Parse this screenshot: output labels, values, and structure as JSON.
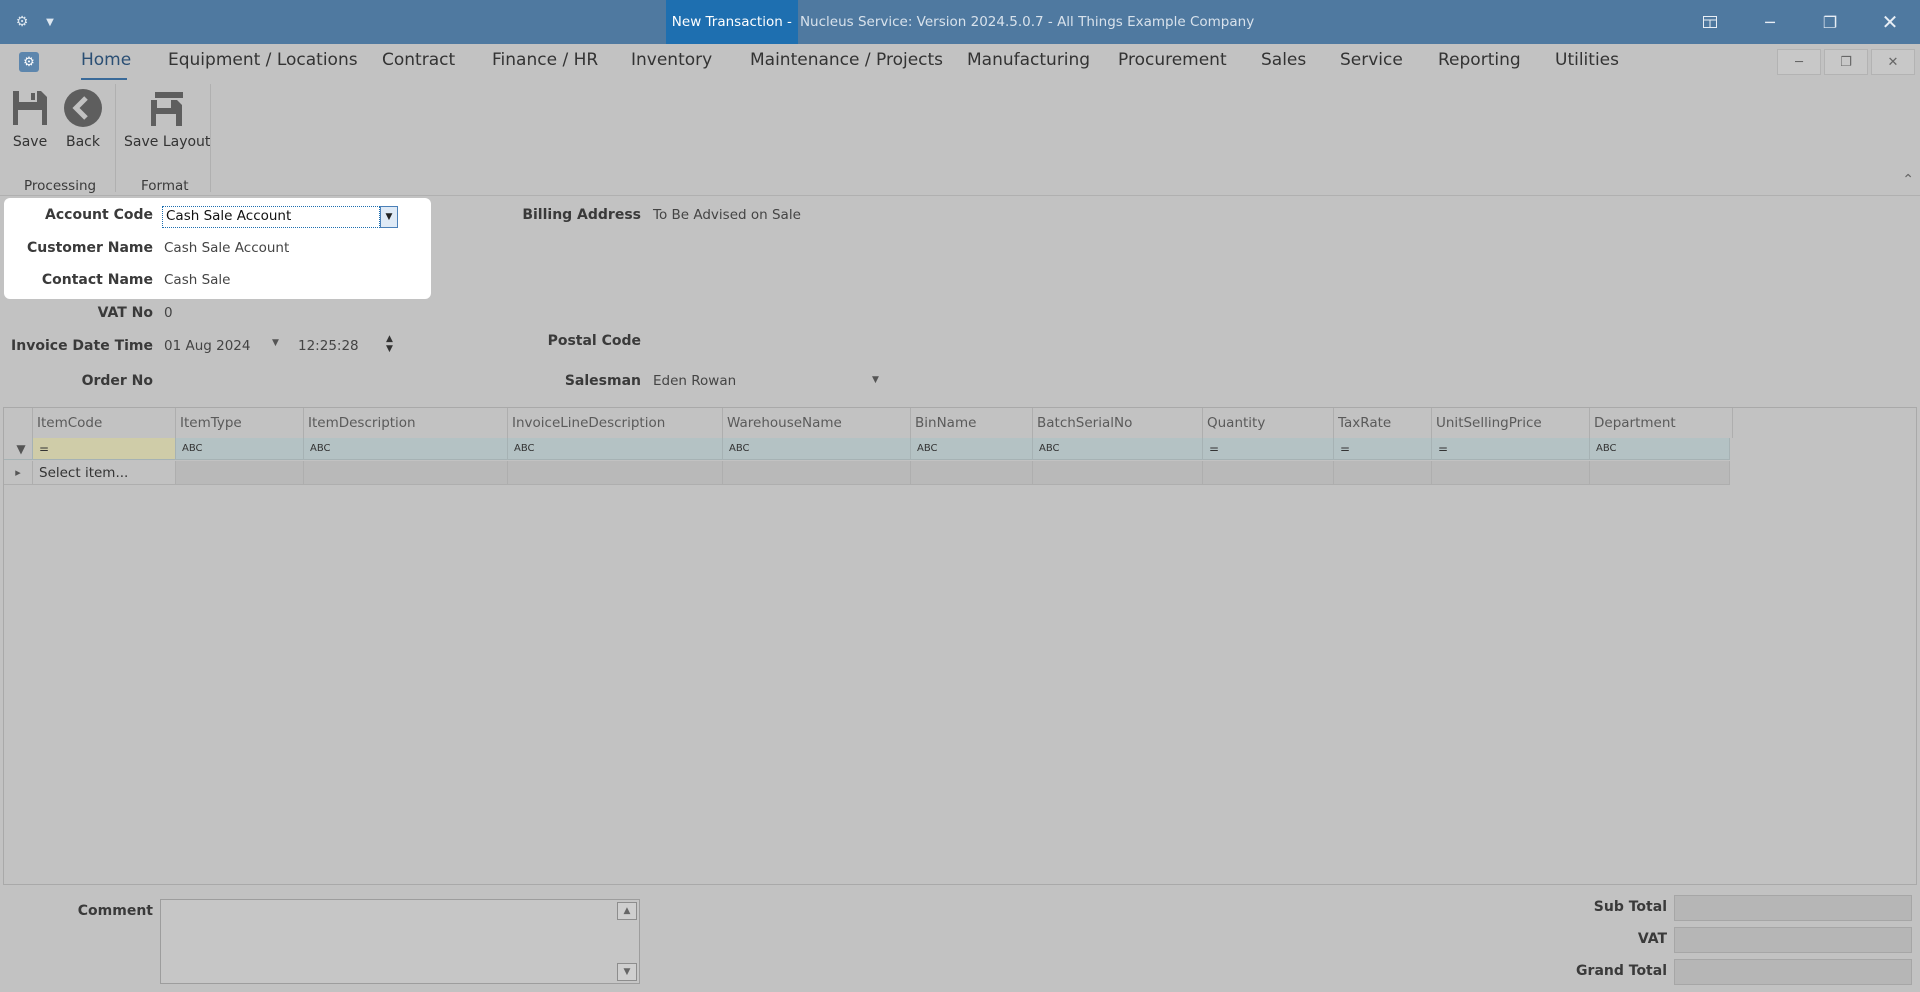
{
  "titlebar": {
    "doc_title": "New Transaction -",
    "rest_title": "Nucleus Service: Version 2024.5.0.7 - All Things Example Company"
  },
  "menu": {
    "items": [
      "Home",
      "Equipment / Locations",
      "Contract",
      "Finance / HR",
      "Inventory",
      "Maintenance / Projects",
      "Manufacturing",
      "Procurement",
      "Sales",
      "Service",
      "Reporting",
      "Utilities"
    ],
    "active": "Home"
  },
  "ribbon": {
    "save": "Save",
    "back": "Back",
    "save_layout": "Save Layout",
    "group_processing": "Processing",
    "group_format": "Format"
  },
  "form": {
    "account_code_label": "Account Code",
    "account_code_value": "Cash Sale Account",
    "customer_name_label": "Customer Name",
    "customer_name_value": "Cash Sale Account",
    "contact_name_label": "Contact Name",
    "contact_name_value": "Cash Sale",
    "vat_no_label": "VAT No",
    "vat_no_value": "0",
    "invoice_dt_label": "Invoice Date Time",
    "invoice_date": "01 Aug 2024",
    "invoice_time": "12:25:28",
    "order_no_label": "Order No",
    "billing_address_label": "Billing Address",
    "billing_address_value": "To Be Advised on Sale",
    "postal_code_label": "Postal Code",
    "salesman_label": "Salesman",
    "salesman_value": "Eden Rowan"
  },
  "grid": {
    "columns": [
      "ItemCode",
      "ItemType",
      "ItemDescription",
      "InvoiceLineDescription",
      "WarehouseName",
      "BinName",
      "BatchSerialNo",
      "Quantity",
      "TaxRate",
      "UnitSellingPrice",
      "Department"
    ],
    "filter_ops": [
      "=",
      "ABC",
      "ABC",
      "ABC",
      "ABC",
      "ABC",
      "ABC",
      "=",
      "=",
      "=",
      "ABC"
    ],
    "new_row_text": "Select item..."
  },
  "footer": {
    "comment_label": "Comment",
    "sub_total_label": "Sub Total",
    "vat_label": "VAT",
    "grand_total_label": "Grand Total"
  },
  "colors": {
    "titlebar": "#4f79a0",
    "title_highlight": "#1e6fb0",
    "accent": "#3a6a99"
  }
}
